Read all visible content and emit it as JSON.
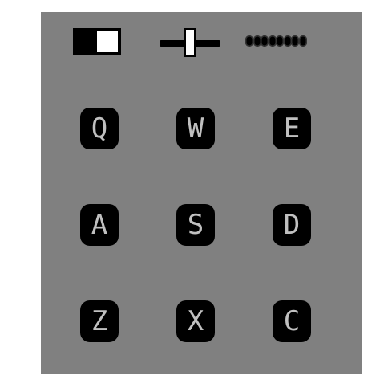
{
  "controls": {
    "toggle": {
      "state": "on"
    },
    "slider": {
      "value": 0.5
    },
    "dots": {
      "count": 8
    }
  },
  "keys": [
    [
      "Q",
      "W",
      "E"
    ],
    [
      "A",
      "S",
      "D"
    ],
    [
      "Z",
      "X",
      "C"
    ]
  ],
  "colors": {
    "background": "#808080",
    "key": "#000000",
    "key_text": "#c0c0c0",
    "toggle_knob": "#ffffff"
  }
}
